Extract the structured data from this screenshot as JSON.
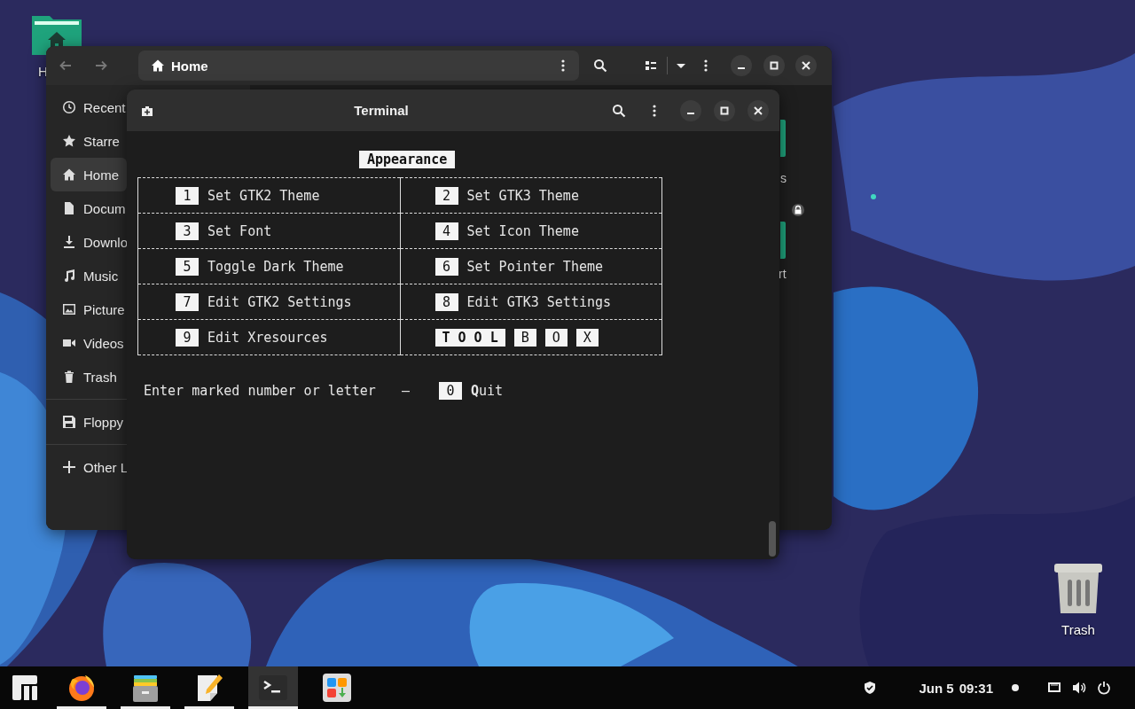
{
  "desktop_icons": [
    {
      "kind": "home-folder",
      "label": "H"
    },
    {
      "kind": "trash",
      "label": "Trash"
    }
  ],
  "file_manager": {
    "path": "Home",
    "sidebar": [
      {
        "items": [
          {
            "kind": "recent",
            "label": "Recent",
            "selected": false
          },
          {
            "kind": "starred",
            "label": "Starre",
            "selected": false
          },
          {
            "kind": "home",
            "label": "Home",
            "selected": true
          },
          {
            "kind": "documents",
            "label": "Docum",
            "selected": false
          },
          {
            "kind": "downloads",
            "label": "Downlo",
            "selected": false
          },
          {
            "kind": "music",
            "label": "Music",
            "selected": false
          },
          {
            "kind": "pictures",
            "label": "Picture",
            "selected": false
          },
          {
            "kind": "videos",
            "label": "Videos",
            "selected": false
          },
          {
            "kind": "trash",
            "label": "Trash",
            "selected": false
          }
        ]
      },
      {
        "items": [
          {
            "kind": "floppy",
            "label": "Floppy",
            "selected": false
          }
        ]
      },
      {
        "items": [
          {
            "kind": "other",
            "label": "Other L",
            "selected": false
          }
        ]
      }
    ],
    "content_fragments": [
      {
        "label": "s",
        "locked": true
      },
      {
        "label": "rt"
      }
    ]
  },
  "terminal": {
    "title": "Terminal",
    "menu_title": "Appearance",
    "rows": [
      {
        "cells": [
          {
            "kind": "option",
            "key": "1",
            "label": "Set GTK2 Theme"
          },
          {
            "kind": "option",
            "key": "2",
            "label": "Set GTK3 Theme"
          }
        ]
      },
      {
        "cells": [
          {
            "kind": "option",
            "key": "3",
            "label": "Set Font"
          },
          {
            "kind": "option",
            "key": "4",
            "label": "Set Icon Theme"
          }
        ]
      },
      {
        "cells": [
          {
            "kind": "option",
            "key": "5",
            "label": "Toggle Dark Theme"
          },
          {
            "kind": "option",
            "key": "6",
            "label": "Set Pointer Theme"
          }
        ]
      },
      {
        "cells": [
          {
            "kind": "option",
            "key": "7",
            "label": "Edit GTK2 Settings"
          },
          {
            "kind": "option",
            "key": "8",
            "label": "Edit GTK3 Settings"
          }
        ]
      },
      {
        "cells": [
          {
            "kind": "option",
            "key": "9",
            "label": "Edit Xresources"
          },
          {
            "kind": "toolbox",
            "keys": [
              {
                "kind": "word",
                "text": "T O O L"
              },
              {
                "kind": "letter",
                "text": "B"
              },
              {
                "kind": "letter",
                "text": "O"
              },
              {
                "kind": "letter",
                "text": "X"
              }
            ]
          }
        ]
      }
    ],
    "prompt": {
      "text": "Enter marked number or letter",
      "separator": "–",
      "key": "0",
      "label": "**Q**uit"
    }
  },
  "taskbar": {
    "launchers": [
      {
        "kind": "menu",
        "running": false,
        "active": false
      },
      {
        "kind": "browser",
        "running": true,
        "active": false
      },
      {
        "kind": "files",
        "running": true,
        "active": false
      },
      {
        "kind": "editor",
        "running": true,
        "active": false
      },
      {
        "kind": "terminal",
        "running": true,
        "active": true
      },
      {
        "kind": "store",
        "running": false,
        "active": false
      }
    ],
    "date": "Jun 5",
    "time": "09:31"
  }
}
